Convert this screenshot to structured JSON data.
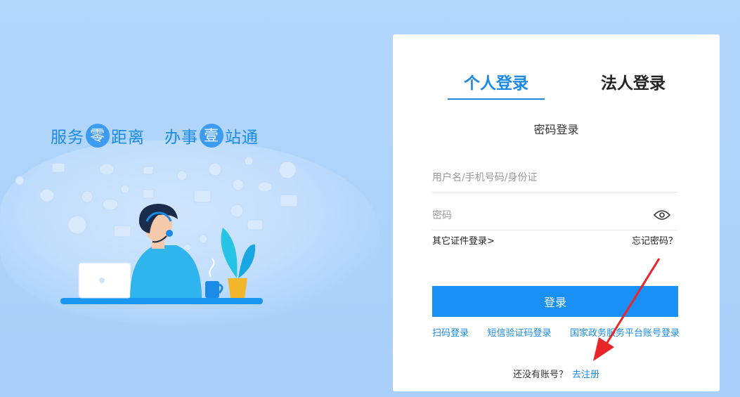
{
  "slogan": {
    "part1": "服务",
    "circle1": "零",
    "part2": "距离",
    "part3": "办事",
    "circle2": "壹",
    "part4": "站通"
  },
  "login": {
    "tabs": [
      {
        "label": "个人登录",
        "active": true
      },
      {
        "label": "法人登录",
        "active": false
      }
    ],
    "subtitle": "密码登录",
    "username_placeholder": "用户名/手机号码/身份证",
    "password_placeholder": "密码",
    "other_cert_login": "其它证件登录>",
    "forgot_password": "忘记密码？",
    "submit_label": "登录",
    "alt_logins": [
      "扫码登录",
      "短信验证码登录",
      "国家政务服务平台账号登录"
    ],
    "register_prompt": "还没有账号？",
    "register_link": "去注册"
  },
  "colors": {
    "accent": "#1b8ae6",
    "button": "#1890f5",
    "background": "#b3d6fb",
    "annotation_arrow": "#e8262a"
  }
}
